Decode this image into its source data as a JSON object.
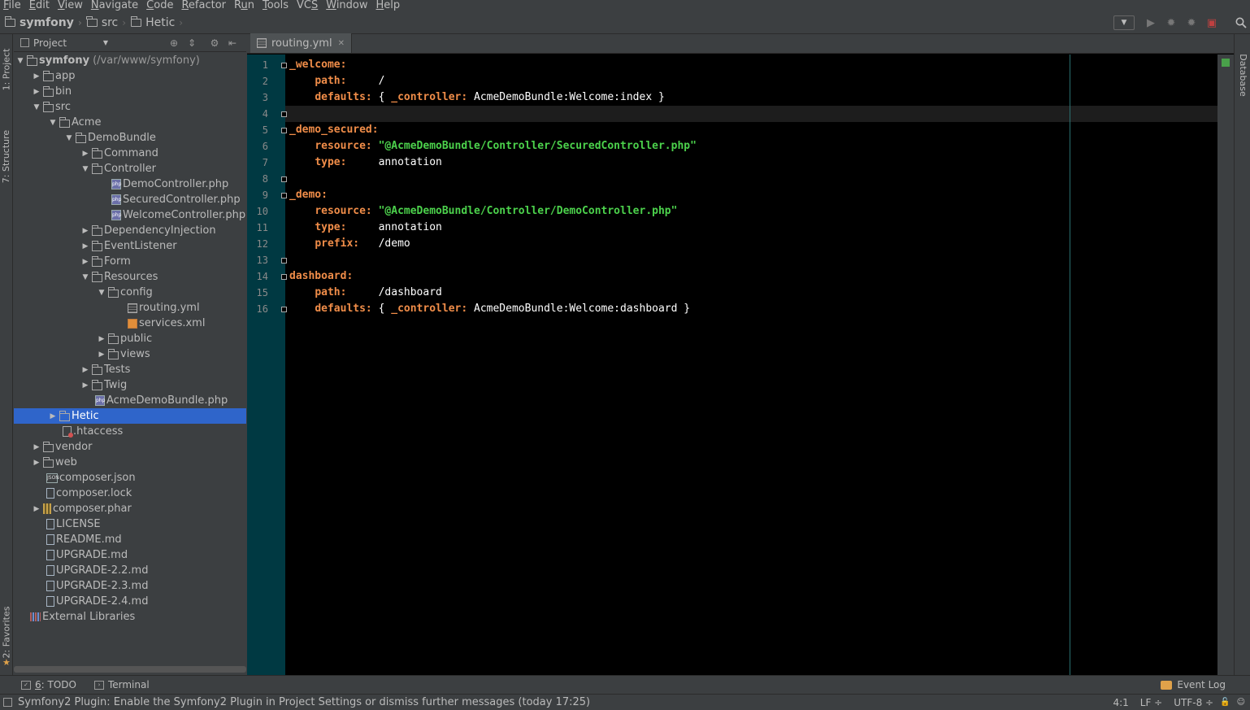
{
  "menu": [
    {
      "pre": "",
      "mn": "F",
      "post": "ile"
    },
    {
      "pre": "",
      "mn": "E",
      "post": "dit"
    },
    {
      "pre": "",
      "mn": "V",
      "post": "iew"
    },
    {
      "pre": "",
      "mn": "N",
      "post": "avigate"
    },
    {
      "pre": "",
      "mn": "C",
      "post": "ode"
    },
    {
      "pre": "",
      "mn": "R",
      "post": "efactor"
    },
    {
      "pre": "R",
      "mn": "u",
      "post": "n"
    },
    {
      "pre": "",
      "mn": "T",
      "post": "ools"
    },
    {
      "pre": "VC",
      "mn": "S",
      "post": ""
    },
    {
      "pre": "",
      "mn": "W",
      "post": "indow"
    },
    {
      "pre": "",
      "mn": "H",
      "post": "elp"
    }
  ],
  "breadcrumb": [
    "symfony",
    "src",
    "Hetic"
  ],
  "left_stripe": {
    "project": "1: Project",
    "structure": "7: Structure",
    "favorites": "2: Favorites"
  },
  "right_stripe": {
    "database": "Database"
  },
  "project_panel": {
    "title": "Project"
  },
  "tree": [
    {
      "label": "symfony",
      "path": "(/var/www/symfony)",
      "depth": 0,
      "toggle": "open",
      "icon": "folder",
      "bold": true
    },
    {
      "label": "app",
      "depth": 1,
      "toggle": "closed",
      "icon": "folder"
    },
    {
      "label": "bin",
      "depth": 1,
      "toggle": "closed",
      "icon": "folder"
    },
    {
      "label": "src",
      "depth": 1,
      "toggle": "open",
      "icon": "folder"
    },
    {
      "label": "Acme",
      "depth": 2,
      "toggle": "open",
      "icon": "folder"
    },
    {
      "label": "DemoBundle",
      "depth": 3,
      "toggle": "open",
      "icon": "folder"
    },
    {
      "label": "Command",
      "depth": 4,
      "toggle": "closed",
      "icon": "folder"
    },
    {
      "label": "Controller",
      "depth": 4,
      "toggle": "open",
      "icon": "folder"
    },
    {
      "label": "DemoController.php",
      "depth": 5,
      "toggle": "none",
      "icon": "php"
    },
    {
      "label": "SecuredController.php",
      "depth": 5,
      "toggle": "none",
      "icon": "php"
    },
    {
      "label": "WelcomeController.php",
      "depth": 5,
      "toggle": "none",
      "icon": "php"
    },
    {
      "label": "DependencyInjection",
      "depth": 4,
      "toggle": "closed",
      "icon": "folder"
    },
    {
      "label": "EventListener",
      "depth": 4,
      "toggle": "closed",
      "icon": "folder"
    },
    {
      "label": "Form",
      "depth": 4,
      "toggle": "closed",
      "icon": "folder"
    },
    {
      "label": "Resources",
      "depth": 4,
      "toggle": "open",
      "icon": "folder"
    },
    {
      "label": "config",
      "depth": 5,
      "toggle": "open",
      "icon": "folder"
    },
    {
      "label": "routing.yml",
      "depth": 6,
      "toggle": "none",
      "icon": "yml"
    },
    {
      "label": "services.xml",
      "depth": 6,
      "toggle": "none",
      "icon": "xml"
    },
    {
      "label": "public",
      "depth": 5,
      "toggle": "closed",
      "icon": "folder"
    },
    {
      "label": "views",
      "depth": 5,
      "toggle": "closed",
      "icon": "folder"
    },
    {
      "label": "Tests",
      "depth": 4,
      "toggle": "closed",
      "icon": "folder"
    },
    {
      "label": "Twig",
      "depth": 4,
      "toggle": "closed",
      "icon": "folder"
    },
    {
      "label": "AcmeDemoBundle.php",
      "depth": 4,
      "toggle": "none",
      "icon": "php"
    },
    {
      "label": "Hetic",
      "depth": 2,
      "toggle": "closed",
      "icon": "folder",
      "selected": true
    },
    {
      "label": ".htaccess",
      "depth": 2,
      "toggle": "none",
      "icon": "ht"
    },
    {
      "label": "vendor",
      "depth": 1,
      "toggle": "closed",
      "icon": "folder"
    },
    {
      "label": "web",
      "depth": 1,
      "toggle": "closed",
      "icon": "folder"
    },
    {
      "label": "composer.json",
      "depth": 1,
      "toggle": "none",
      "icon": "json"
    },
    {
      "label": "composer.lock",
      "depth": 1,
      "toggle": "none",
      "icon": "file"
    },
    {
      "label": "composer.phar",
      "depth": 1,
      "toggle": "closed",
      "icon": "phar"
    },
    {
      "label": "LICENSE",
      "depth": 1,
      "toggle": "none",
      "icon": "file"
    },
    {
      "label": "README.md",
      "depth": 1,
      "toggle": "none",
      "icon": "file"
    },
    {
      "label": "UPGRADE.md",
      "depth": 1,
      "toggle": "none",
      "icon": "file"
    },
    {
      "label": "UPGRADE-2.2.md",
      "depth": 1,
      "toggle": "none",
      "icon": "file"
    },
    {
      "label": "UPGRADE-2.3.md",
      "depth": 1,
      "toggle": "none",
      "icon": "file"
    },
    {
      "label": "UPGRADE-2.4.md",
      "depth": 1,
      "toggle": "none",
      "icon": "file"
    },
    {
      "label": "External Libraries",
      "depth": 0,
      "toggle": "none",
      "icon": "lib"
    }
  ],
  "editor": {
    "tab": "routing.yml",
    "current_line": 4,
    "lines": [
      [
        {
          "t": "key",
          "s": "_welcome:"
        }
      ],
      [
        {
          "t": "plain",
          "s": "    "
        },
        {
          "t": "key",
          "s": "path:"
        },
        {
          "t": "plain",
          "s": "     /"
        }
      ],
      [
        {
          "t": "plain",
          "s": "    "
        },
        {
          "t": "key",
          "s": "defaults:"
        },
        {
          "t": "plain",
          "s": " { "
        },
        {
          "t": "key",
          "s": "_controller:"
        },
        {
          "t": "plain",
          "s": " AcmeDemoBundle:Welcome:index }"
        }
      ],
      [],
      [
        {
          "t": "key",
          "s": "_demo_secured:"
        }
      ],
      [
        {
          "t": "plain",
          "s": "    "
        },
        {
          "t": "key",
          "s": "resource:"
        },
        {
          "t": "plain",
          "s": " "
        },
        {
          "t": "str",
          "s": "\"@AcmeDemoBundle/Controller/SecuredController.php\""
        }
      ],
      [
        {
          "t": "plain",
          "s": "    "
        },
        {
          "t": "key",
          "s": "type:"
        },
        {
          "t": "plain",
          "s": "     annotation"
        }
      ],
      [],
      [
        {
          "t": "key",
          "s": "_demo:"
        }
      ],
      [
        {
          "t": "plain",
          "s": "    "
        },
        {
          "t": "key",
          "s": "resource:"
        },
        {
          "t": "plain",
          "s": " "
        },
        {
          "t": "str",
          "s": "\"@AcmeDemoBundle/Controller/DemoController.php\""
        }
      ],
      [
        {
          "t": "plain",
          "s": "    "
        },
        {
          "t": "key",
          "s": "type:"
        },
        {
          "t": "plain",
          "s": "     annotation"
        }
      ],
      [
        {
          "t": "plain",
          "s": "    "
        },
        {
          "t": "key",
          "s": "prefix:"
        },
        {
          "t": "plain",
          "s": "   /demo"
        }
      ],
      [],
      [
        {
          "t": "key",
          "s": "dashboard:"
        }
      ],
      [
        {
          "t": "plain",
          "s": "    "
        },
        {
          "t": "key",
          "s": "path:"
        },
        {
          "t": "plain",
          "s": "     /dashboard"
        }
      ],
      [
        {
          "t": "plain",
          "s": "    "
        },
        {
          "t": "key",
          "s": "defaults:"
        },
        {
          "t": "plain",
          "s": " { "
        },
        {
          "t": "key",
          "s": "_controller:"
        },
        {
          "t": "plain",
          "s": " AcmeDemoBundle:Welcome:dashboard }"
        }
      ]
    ],
    "fold_lines": [
      1,
      4,
      5,
      8,
      9,
      13,
      14,
      16
    ]
  },
  "bottom_tools": {
    "todo_mn": "6",
    "todo_label": ": TODO",
    "terminal_label": "Terminal",
    "event_log_label": "Event Log"
  },
  "status": {
    "message": "Symfony2 Plugin: Enable the Symfony2 Plugin in Project Settings or dismiss further messages (today 17:25)",
    "position": "4:1",
    "line_sep": "LF ÷",
    "encoding": "UTF-8 ÷"
  },
  "colors": {
    "key": "#f08d49",
    "string": "#4cd24c",
    "gutter": "#003942",
    "selection": "#2f65ca"
  }
}
